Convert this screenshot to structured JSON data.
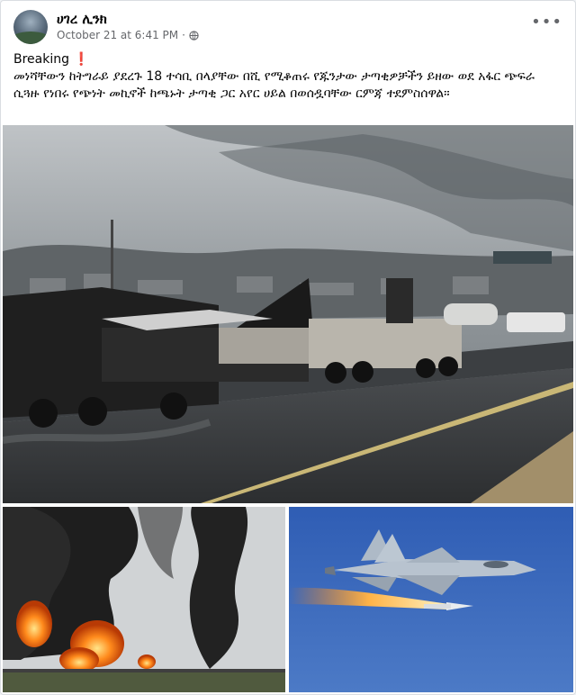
{
  "post": {
    "author": "ሀገረ ሊንክ",
    "timestamp": "October 21 at 6:41 PM",
    "separator": "·",
    "privacy_icon": "globe-icon",
    "more_label": "•••",
    "breaking_label": "Breaking",
    "breaking_icon": "❗",
    "body": "መነሻቸውን ከትግራይ ያደረጉ 18 ተሳቢ በላያቸው በሺ የሚቆጠሩ የጁንታው ታጣቂዎቻችን ይዘው ወደ አፋር ጭፍራ ሲጓዙ የነበሩ የጭነት መኪኖች ከጫኑት ታጣቂ ጋር አየር ሀይል በወሰዷባቸው ርምጃ ተደምስሰዋል።"
  },
  "colors": {
    "author": "#050505",
    "meta": "#65676b",
    "accent_red": "#e02020"
  }
}
